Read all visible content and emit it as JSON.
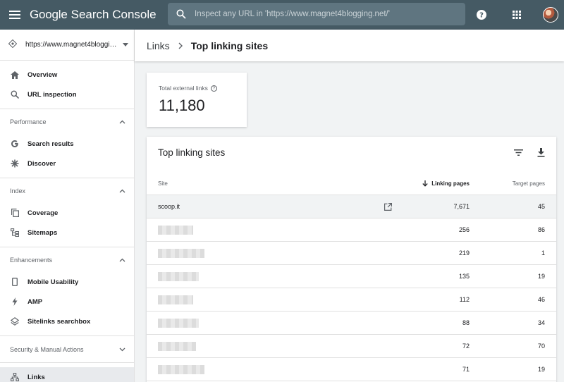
{
  "app": {
    "brand_google": "Google",
    "brand_product": "Search Console"
  },
  "search": {
    "placeholder": "Inspect any URL in 'https://www.magnet4blogging.net/'"
  },
  "sidebar": {
    "property": "https://www.magnet4blogging.net/",
    "items_top": [
      {
        "label": "Overview",
        "icon": "home-icon"
      },
      {
        "label": "URL inspection",
        "icon": "search-icon"
      }
    ],
    "sections": [
      {
        "title": "Performance",
        "expanded": true,
        "items": [
          {
            "label": "Search results",
            "icon": "google-g-icon"
          },
          {
            "label": "Discover",
            "icon": "asterisk-icon"
          }
        ]
      },
      {
        "title": "Index",
        "expanded": true,
        "items": [
          {
            "label": "Coverage",
            "icon": "copy-icon"
          },
          {
            "label": "Sitemaps",
            "icon": "sitemap-icon"
          }
        ]
      },
      {
        "title": "Enhancements",
        "expanded": true,
        "items": [
          {
            "label": "Mobile Usability",
            "icon": "phone-icon"
          },
          {
            "label": "AMP",
            "icon": "bolt-icon"
          },
          {
            "label": "Sitelinks searchbox",
            "icon": "layers-icon"
          }
        ]
      },
      {
        "title": "Security & Manual Actions",
        "expanded": false,
        "items": []
      }
    ],
    "links_item": {
      "label": "Links",
      "icon": "network-icon"
    }
  },
  "breadcrumb": {
    "parent": "Links",
    "current": "Top linking sites"
  },
  "metric": {
    "label": "Total external links",
    "value": "11,180"
  },
  "table": {
    "title": "Top linking sites",
    "col_site": "Site",
    "col_linking": "Linking pages",
    "col_target": "Target pages",
    "rows": [
      {
        "site": "scoop.it",
        "linking": "7,671",
        "target": "45"
      },
      {
        "site": "",
        "linking": "256",
        "target": "86"
      },
      {
        "site": "",
        "linking": "219",
        "target": "1"
      },
      {
        "site": "",
        "linking": "135",
        "target": "19"
      },
      {
        "site": "",
        "linking": "112",
        "target": "46"
      },
      {
        "site": "",
        "linking": "88",
        "target": "34"
      },
      {
        "site": "",
        "linking": "72",
        "target": "70"
      },
      {
        "site": "",
        "linking": "71",
        "target": "19"
      }
    ]
  },
  "colors": {
    "topbar": "#455a64",
    "search_bg": "#5f7580",
    "selected_row": "#f1f3f4"
  }
}
